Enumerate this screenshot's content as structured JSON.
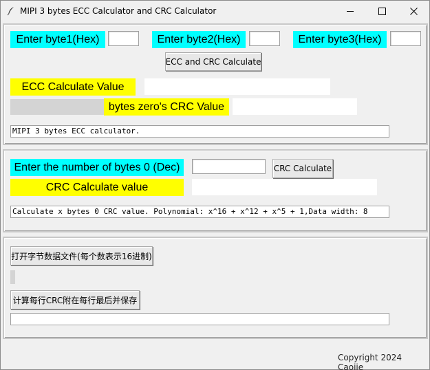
{
  "window": {
    "title": "MIPI 3 bytes ECC Calculator and CRC Calculator",
    "icon": "feather-icon",
    "controls": [
      "minimize-icon",
      "maximize-icon",
      "close-icon"
    ]
  },
  "ecc_section": {
    "byte1_label": "Enter byte1(Hex)",
    "byte1_value": "",
    "byte2_label": "Enter byte2(Hex)",
    "byte2_value": "",
    "byte3_label": "Enter byte3(Hex)",
    "byte3_value": "",
    "calc_button": "ECC and CRC Calculate",
    "ecc_value_label": "ECC Calculate Value",
    "ecc_value": "",
    "crc_zero_label": "bytes zero's CRC Value",
    "crc_zero_value": "",
    "status": "MIPI 3 bytes ECC calculator."
  },
  "crc_section": {
    "num_bytes_label": "Enter the number of bytes 0 (Dec)",
    "num_bytes_value": "",
    "calc_button": "CRC Calculate",
    "crc_value_label": "CRC Calculate value",
    "crc_value": "",
    "status": "Calculate x bytes 0 CRC value. Polynomial: x^16 + x^12 + x^5 + 1,Data width: 8"
  },
  "file_section": {
    "open_button": "打开字节数据文件(每个数表示16进制)",
    "save_button": "计算每行CRC附在每行最后并保存",
    "status": ""
  },
  "footer": {
    "copyright": "Copyright 2024 Caojie"
  },
  "colors": {
    "label_cyan": "#00ffff",
    "label_yellow": "#ffff00"
  }
}
